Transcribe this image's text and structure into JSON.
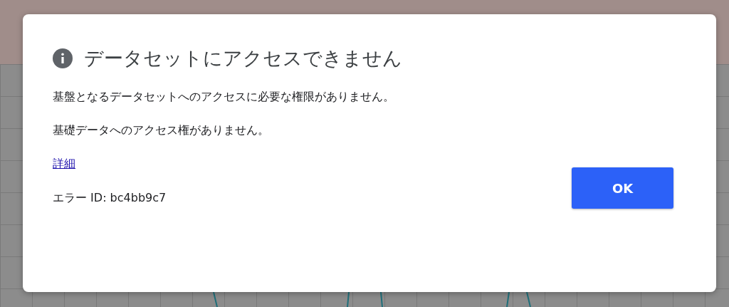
{
  "dialog": {
    "title": "データセットにアクセスできません",
    "messages": [
      "基盤となるデータセットへのアクセスに必要な権限がありません。",
      "基礎データへのアクセス権がありません。"
    ],
    "details_link": "詳細",
    "error_id": "エラー ID: bc4bb9c7",
    "buttons": [
      "OK"
    ]
  }
}
